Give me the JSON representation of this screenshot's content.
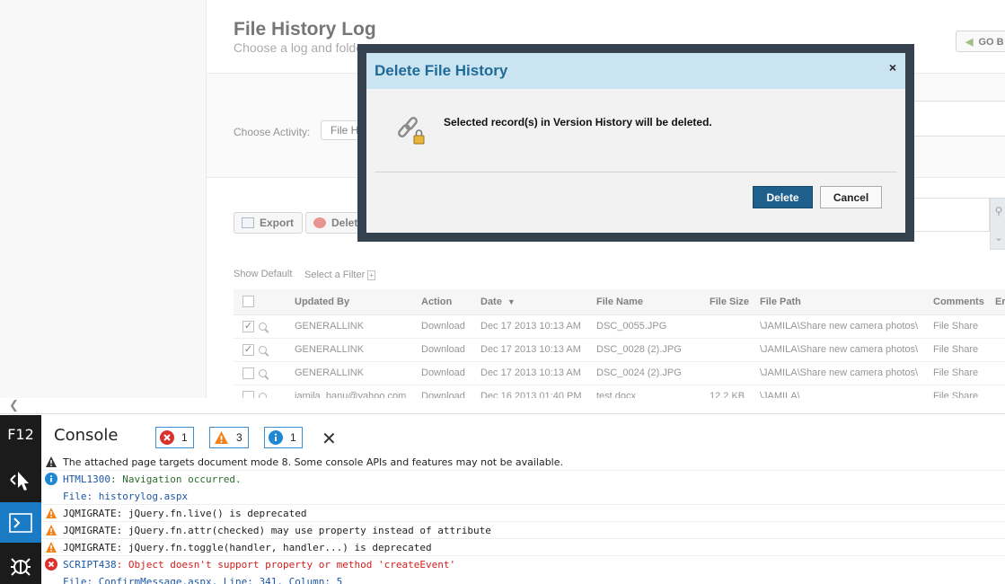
{
  "page": {
    "title": "File History Log",
    "subtitle": "Choose a log and folde",
    "go_button": "GO B",
    "choose_activity_label": "Choose Activity:",
    "activity_value": "File H",
    "export_label": "Export",
    "delete_label": "Delet",
    "show_default": "Show Default",
    "select_filter": "Select a Filter"
  },
  "table": {
    "columns": [
      "Updated By",
      "Action",
      "Date",
      "File Name",
      "File Size",
      "File Path",
      "Comments",
      "Er"
    ],
    "rows": [
      {
        "checked": "✓",
        "updated_by": "GENERALLINK",
        "action": "Download",
        "date": "Dec 17 2013 10:13 AM",
        "file_name": "DSC_0055.JPG",
        "file_size": "",
        "file_path": "\\JAMILA\\Share new camera photos\\",
        "comments": "File Share"
      },
      {
        "checked": "✓",
        "updated_by": "GENERALLINK",
        "action": "Download",
        "date": "Dec 17 2013 10:13 AM",
        "file_name": "DSC_0028 (2).JPG",
        "file_size": "",
        "file_path": "\\JAMILA\\Share new camera photos\\",
        "comments": "File Share"
      },
      {
        "checked": "",
        "updated_by": "GENERALLINK",
        "action": "Download",
        "date": "Dec 17 2013 10:13 AM",
        "file_name": "DSC_0024 (2).JPG",
        "file_size": "",
        "file_path": "\\JAMILA\\Share new camera photos\\",
        "comments": "File Share"
      },
      {
        "checked": "",
        "updated_by": "jamila_banu@yahoo.com",
        "action": "Download",
        "date": "Dec 16 2013 01:40 PM",
        "file_name": "test.docx",
        "file_size": "12.2 KB",
        "file_path": "\\JAMILA\\",
        "comments": "File Share"
      }
    ]
  },
  "dialog": {
    "title": "Delete File History",
    "close": "×",
    "message": "Selected record(s) in Version History will be deleted.",
    "delete_button": "Delete",
    "cancel_button": "Cancel"
  },
  "devtools": {
    "f12_label": "F12",
    "console_title": "Console",
    "error_count": "1",
    "warning_count": "3",
    "info_count": "1",
    "close": "✕",
    "log": [
      {
        "type": "warning-mode",
        "text": "The attached page targets document mode 8.  Some console APIs and features may not be available."
      },
      {
        "type": "info",
        "code": "HTML1300",
        "text": ": Navigation occurred."
      },
      {
        "type": "file",
        "text": "File: historylog.aspx"
      },
      {
        "type": "warning",
        "text": "JQMIGRATE: jQuery.fn.live() is deprecated"
      },
      {
        "type": "warning",
        "text": "JQMIGRATE: jQuery.fn.attr(checked) may use property instead of attribute"
      },
      {
        "type": "warning",
        "text": "JQMIGRATE: jQuery.fn.toggle(handler, handler...) is deprecated"
      },
      {
        "type": "error",
        "code": "SCRIPT438",
        "text": ": Object doesn't support property or method 'createEvent'"
      },
      {
        "type": "file",
        "text": "File: ConfirmMessage.aspx, Line: 341, Column: 5"
      }
    ]
  },
  "colors": {
    "dialog_header": "#cbe4f1",
    "dialog_title": "#1f6b97",
    "primary_button": "#1f5f8b",
    "f12_active": "#1a7bc4",
    "error": "#d21d1d"
  }
}
